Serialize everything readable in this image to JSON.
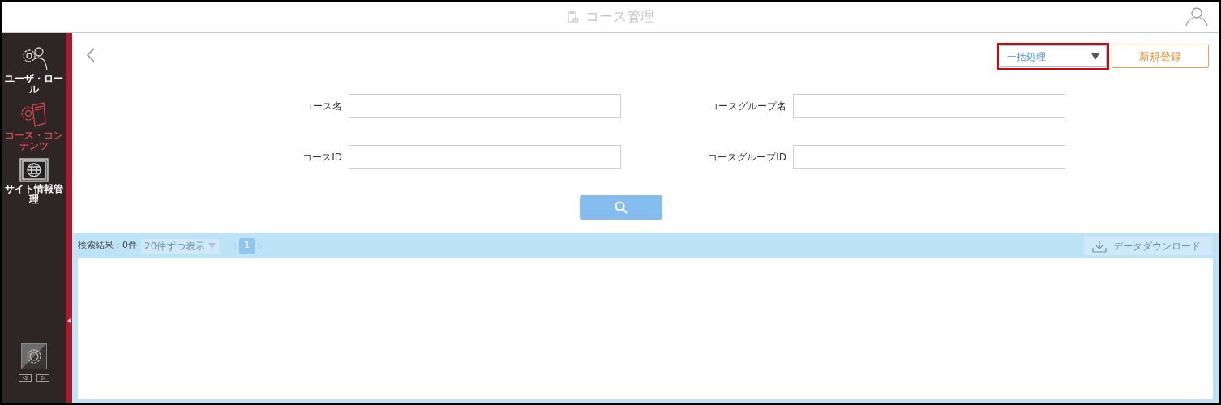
{
  "header": {
    "title": "コース管理"
  },
  "sidebar": {
    "items": [
      {
        "label": "ユーザ・ロール",
        "kind": "users",
        "selected": false
      },
      {
        "label": "コース・コンテンツ",
        "kind": "book",
        "selected": true
      },
      {
        "label": "サイト情報管理",
        "kind": "globe",
        "selected": false
      }
    ]
  },
  "toolbar": {
    "bulk_action": {
      "value": "一括処理"
    },
    "new_button": "新規登録"
  },
  "form": {
    "fields": [
      {
        "label": "コース名"
      },
      {
        "label": "コースグループ名"
      },
      {
        "label": "コースID"
      },
      {
        "label": "コースグループID"
      }
    ]
  },
  "results": {
    "count_label": "検索結果：0件",
    "page_size": "20件ずつ表示",
    "pages": [
      {
        "label": "1",
        "selected": true
      }
    ],
    "download": {
      "label": "データダウンロード",
      "disabled": true
    }
  }
}
